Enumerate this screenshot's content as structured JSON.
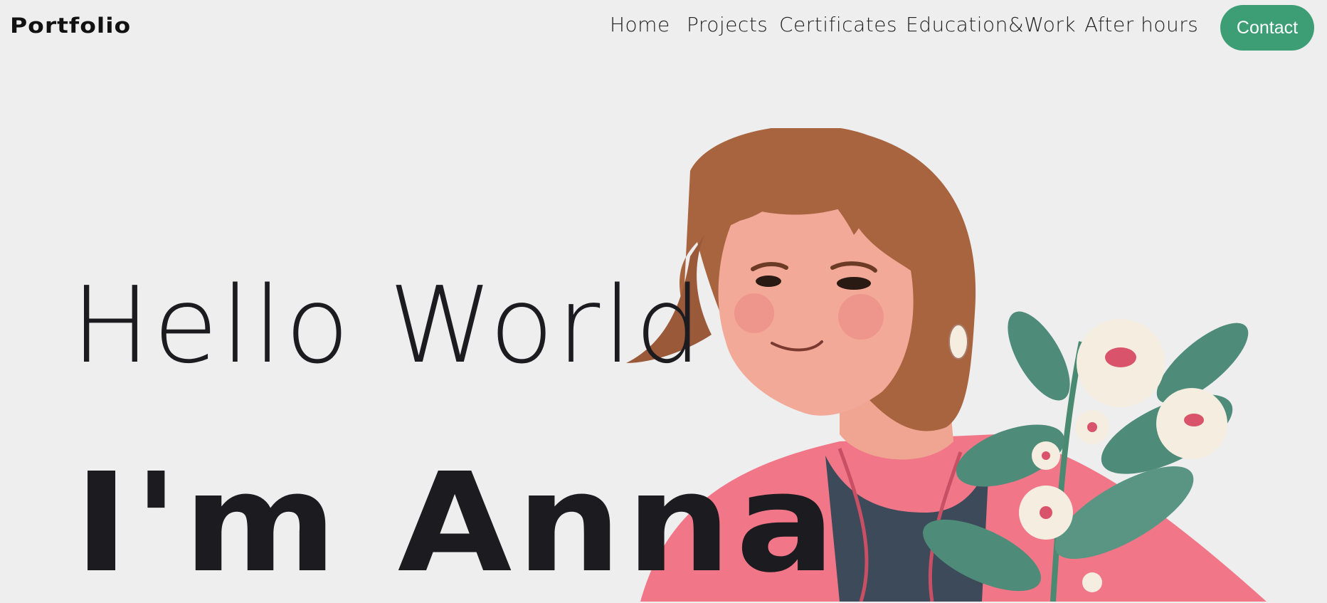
{
  "header": {
    "logo": "Portfolio",
    "nav": [
      {
        "label": "Home"
      },
      {
        "label": "Projects"
      },
      {
        "label": "Certificates"
      },
      {
        "label": "Education&Work"
      },
      {
        "label": "After hours"
      }
    ],
    "contact_label": "Contact"
  },
  "hero": {
    "greeting": "Hello World",
    "name": "I'm Anna"
  },
  "colors": {
    "background": "#eeeeee",
    "accent": "#3d9e76",
    "text": "#1c1b20"
  }
}
